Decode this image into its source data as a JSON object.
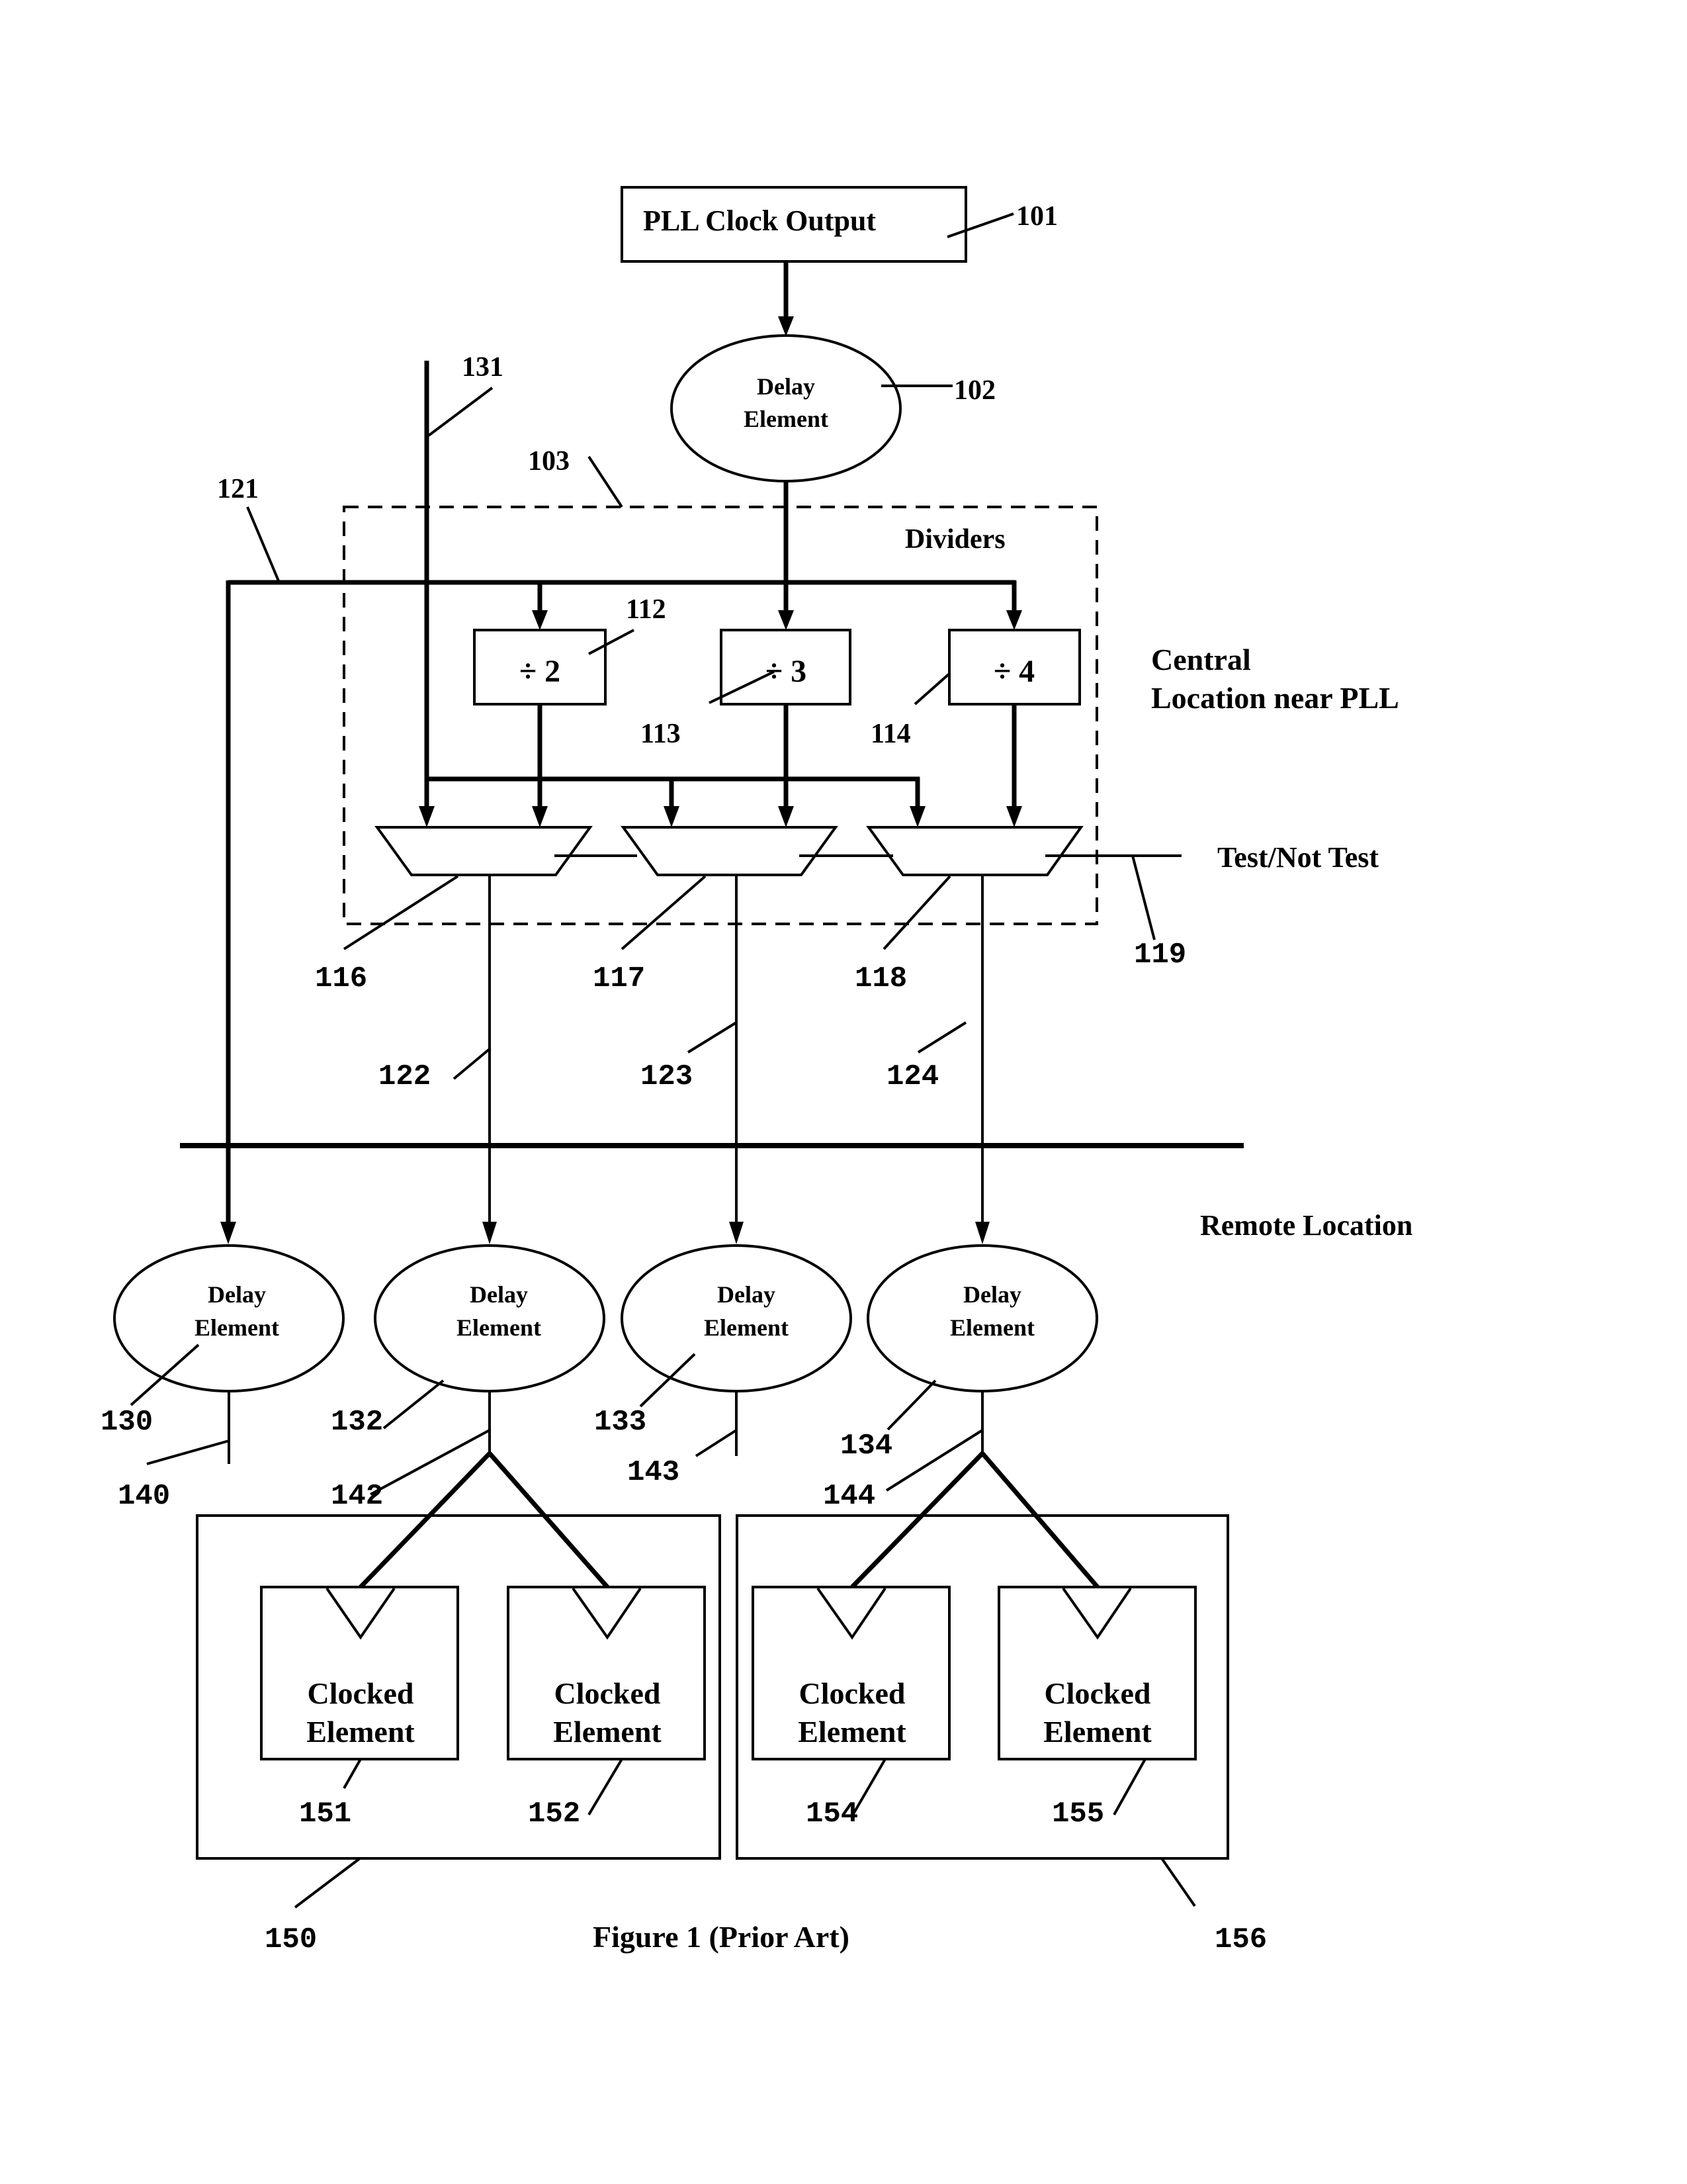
{
  "figure": {
    "caption": "Figure 1 (Prior Art)"
  },
  "pll": {
    "label": "PLL Clock Output",
    "ref": "101"
  },
  "central_delay": {
    "line1": "Delay",
    "line2": "Element",
    "ref": "102"
  },
  "dividers_group": {
    "title": "Dividers",
    "ref": "103"
  },
  "dividers": [
    {
      "label": "÷ 2",
      "ref": "112"
    },
    {
      "label": "÷ 3",
      "ref": "113"
    },
    {
      "label": "÷ 4",
      "ref": "114"
    }
  ],
  "muxes": [
    {
      "ref": "116"
    },
    {
      "ref": "117"
    },
    {
      "ref": "118"
    }
  ],
  "test_signal": {
    "label": "Test/Not Test",
    "ref": "119"
  },
  "wires": {
    "bypass_ref": "121",
    "test_clock_ref": "131",
    "out1_ref": "122",
    "out2_ref": "123",
    "out3_ref": "124"
  },
  "regions": {
    "central": {
      "line1": "Central",
      "line2": "Location near PLL"
    },
    "remote": "Remote Location"
  },
  "remote_delays": [
    {
      "line1": "Delay",
      "line2": "Element",
      "ref": "130",
      "wire_ref": "140"
    },
    {
      "line1": "Delay",
      "line2": "Element",
      "ref": "132",
      "wire_ref": "142"
    },
    {
      "line1": "Delay",
      "line2": "Element",
      "ref": "133",
      "wire_ref": "143"
    },
    {
      "line1": "Delay",
      "line2": "Element",
      "ref": "134",
      "wire_ref": "144"
    }
  ],
  "clock_domains": [
    {
      "ref": "150",
      "elements": [
        {
          "line1": "Clocked",
          "line2": "Element",
          "ref": "151"
        },
        {
          "line1": "Clocked",
          "line2": "Element",
          "ref": "152"
        }
      ]
    },
    {
      "ref": "156",
      "elements": [
        {
          "line1": "Clocked",
          "line2": "Element",
          "ref": "154"
        },
        {
          "line1": "Clocked",
          "line2": "Element",
          "ref": "155"
        }
      ]
    }
  ]
}
